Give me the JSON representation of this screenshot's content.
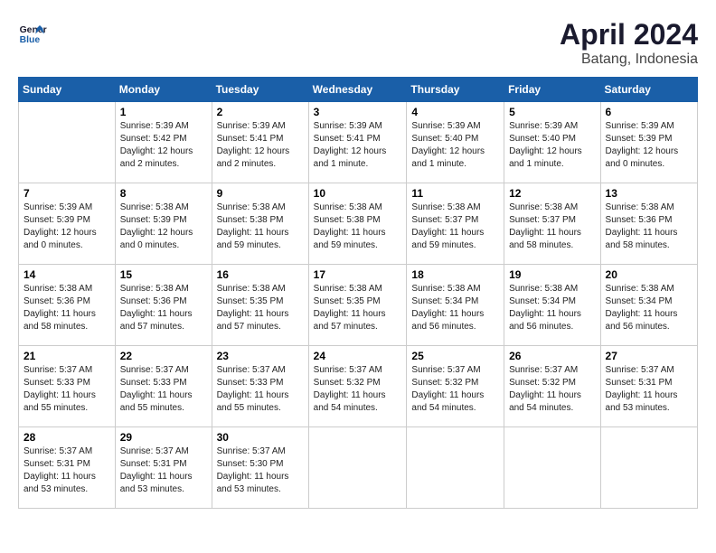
{
  "header": {
    "logo_line1": "General",
    "logo_line2": "Blue",
    "month_title": "April 2024",
    "location": "Batang, Indonesia"
  },
  "days_of_week": [
    "Sunday",
    "Monday",
    "Tuesday",
    "Wednesday",
    "Thursday",
    "Friday",
    "Saturday"
  ],
  "weeks": [
    [
      {
        "day": "",
        "info": ""
      },
      {
        "day": "1",
        "info": "Sunrise: 5:39 AM\nSunset: 5:42 PM\nDaylight: 12 hours\nand 2 minutes."
      },
      {
        "day": "2",
        "info": "Sunrise: 5:39 AM\nSunset: 5:41 PM\nDaylight: 12 hours\nand 2 minutes."
      },
      {
        "day": "3",
        "info": "Sunrise: 5:39 AM\nSunset: 5:41 PM\nDaylight: 12 hours\nand 1 minute."
      },
      {
        "day": "4",
        "info": "Sunrise: 5:39 AM\nSunset: 5:40 PM\nDaylight: 12 hours\nand 1 minute."
      },
      {
        "day": "5",
        "info": "Sunrise: 5:39 AM\nSunset: 5:40 PM\nDaylight: 12 hours\nand 1 minute."
      },
      {
        "day": "6",
        "info": "Sunrise: 5:39 AM\nSunset: 5:39 PM\nDaylight: 12 hours\nand 0 minutes."
      }
    ],
    [
      {
        "day": "7",
        "info": "Sunrise: 5:39 AM\nSunset: 5:39 PM\nDaylight: 12 hours\nand 0 minutes."
      },
      {
        "day": "8",
        "info": "Sunrise: 5:38 AM\nSunset: 5:39 PM\nDaylight: 12 hours\nand 0 minutes."
      },
      {
        "day": "9",
        "info": "Sunrise: 5:38 AM\nSunset: 5:38 PM\nDaylight: 11 hours\nand 59 minutes."
      },
      {
        "day": "10",
        "info": "Sunrise: 5:38 AM\nSunset: 5:38 PM\nDaylight: 11 hours\nand 59 minutes."
      },
      {
        "day": "11",
        "info": "Sunrise: 5:38 AM\nSunset: 5:37 PM\nDaylight: 11 hours\nand 59 minutes."
      },
      {
        "day": "12",
        "info": "Sunrise: 5:38 AM\nSunset: 5:37 PM\nDaylight: 11 hours\nand 58 minutes."
      },
      {
        "day": "13",
        "info": "Sunrise: 5:38 AM\nSunset: 5:36 PM\nDaylight: 11 hours\nand 58 minutes."
      }
    ],
    [
      {
        "day": "14",
        "info": "Sunrise: 5:38 AM\nSunset: 5:36 PM\nDaylight: 11 hours\nand 58 minutes."
      },
      {
        "day": "15",
        "info": "Sunrise: 5:38 AM\nSunset: 5:36 PM\nDaylight: 11 hours\nand 57 minutes."
      },
      {
        "day": "16",
        "info": "Sunrise: 5:38 AM\nSunset: 5:35 PM\nDaylight: 11 hours\nand 57 minutes."
      },
      {
        "day": "17",
        "info": "Sunrise: 5:38 AM\nSunset: 5:35 PM\nDaylight: 11 hours\nand 57 minutes."
      },
      {
        "day": "18",
        "info": "Sunrise: 5:38 AM\nSunset: 5:34 PM\nDaylight: 11 hours\nand 56 minutes."
      },
      {
        "day": "19",
        "info": "Sunrise: 5:38 AM\nSunset: 5:34 PM\nDaylight: 11 hours\nand 56 minutes."
      },
      {
        "day": "20",
        "info": "Sunrise: 5:38 AM\nSunset: 5:34 PM\nDaylight: 11 hours\nand 56 minutes."
      }
    ],
    [
      {
        "day": "21",
        "info": "Sunrise: 5:37 AM\nSunset: 5:33 PM\nDaylight: 11 hours\nand 55 minutes."
      },
      {
        "day": "22",
        "info": "Sunrise: 5:37 AM\nSunset: 5:33 PM\nDaylight: 11 hours\nand 55 minutes."
      },
      {
        "day": "23",
        "info": "Sunrise: 5:37 AM\nSunset: 5:33 PM\nDaylight: 11 hours\nand 55 minutes."
      },
      {
        "day": "24",
        "info": "Sunrise: 5:37 AM\nSunset: 5:32 PM\nDaylight: 11 hours\nand 54 minutes."
      },
      {
        "day": "25",
        "info": "Sunrise: 5:37 AM\nSunset: 5:32 PM\nDaylight: 11 hours\nand 54 minutes."
      },
      {
        "day": "26",
        "info": "Sunrise: 5:37 AM\nSunset: 5:32 PM\nDaylight: 11 hours\nand 54 minutes."
      },
      {
        "day": "27",
        "info": "Sunrise: 5:37 AM\nSunset: 5:31 PM\nDaylight: 11 hours\nand 53 minutes."
      }
    ],
    [
      {
        "day": "28",
        "info": "Sunrise: 5:37 AM\nSunset: 5:31 PM\nDaylight: 11 hours\nand 53 minutes."
      },
      {
        "day": "29",
        "info": "Sunrise: 5:37 AM\nSunset: 5:31 PM\nDaylight: 11 hours\nand 53 minutes."
      },
      {
        "day": "30",
        "info": "Sunrise: 5:37 AM\nSunset: 5:30 PM\nDaylight: 11 hours\nand 53 minutes."
      },
      {
        "day": "",
        "info": ""
      },
      {
        "day": "",
        "info": ""
      },
      {
        "day": "",
        "info": ""
      },
      {
        "day": "",
        "info": ""
      }
    ]
  ]
}
